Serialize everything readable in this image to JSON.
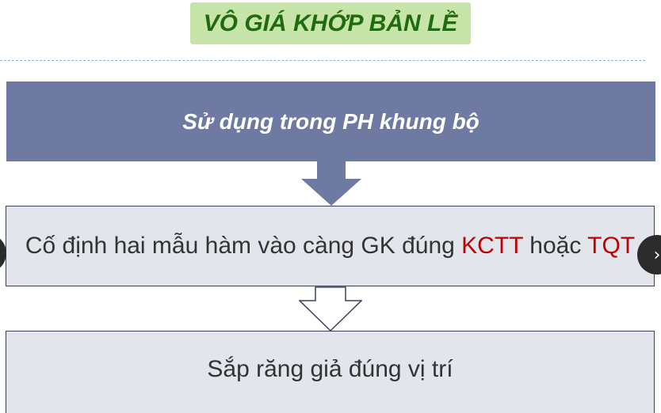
{
  "title": "VÔ GIÁ KHỚP BẢN LỀ",
  "steps": {
    "top": "Sử dụng trong PH khung bộ",
    "middle": {
      "prefix": "Cố định hai mẫu hàm vào càng GK đúng ",
      "highlight1": "KCTT",
      "connector": " hoặc ",
      "highlight2": "TQT"
    },
    "bottom": "Sắp răng giả đúng vị trí"
  },
  "navigation": {
    "prev_icon": "chevron-left-icon",
    "next_icon": "chevron-right-icon",
    "next_glyph": "›"
  },
  "colors": {
    "title_bg": "#c7e5a8",
    "title_text": "#1f6b0f",
    "top_box": "#6f7aa3",
    "light_box": "#e3e5ec",
    "highlight": "#c00000"
  }
}
